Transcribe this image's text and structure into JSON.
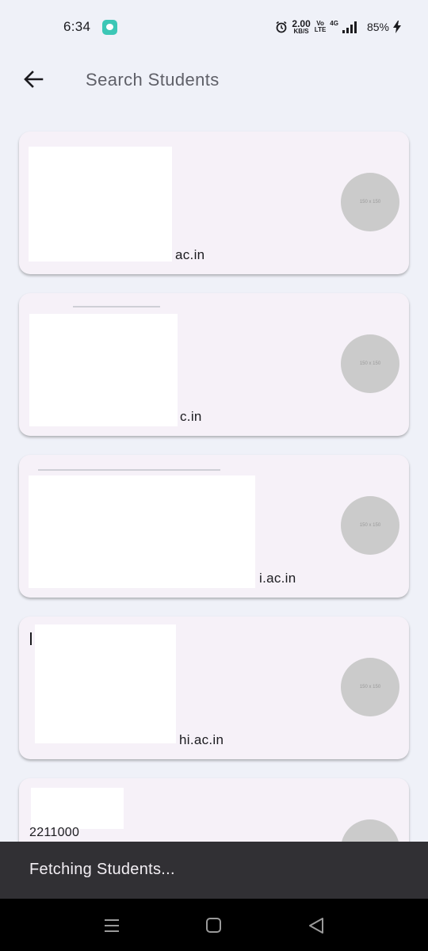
{
  "status_bar": {
    "time": "6:34",
    "net_speed_value": "2.00",
    "net_speed_unit": "KB/S",
    "volte_top": "Vo",
    "volte_bottom": "LTE",
    "network": "4G",
    "battery": "85%",
    "icons": [
      "chat-notification-icon",
      "alarm-icon",
      "signal-icon",
      "charging-bolt-icon"
    ]
  },
  "app_bar": {
    "back_icon": "arrow-left-icon",
    "search_placeholder": "Search Students"
  },
  "students": [
    {
      "email_suffix": "ac.in",
      "avatar_text": "150 x 150"
    },
    {
      "email_suffix": "c.in",
      "avatar_text": "150 x 150"
    },
    {
      "email_suffix": "i.ac.in",
      "avatar_text": "150 x 150"
    },
    {
      "email_suffix": "hi.ac.in",
      "avatar_text": "150 x 150"
    },
    {
      "partial_text": "2211000",
      "avatar_text": ""
    }
  ],
  "snackbar": {
    "message": "Fetching Students..."
  },
  "nav_bar": {
    "icons": [
      "recents-icon",
      "home-icon",
      "back-triangle-icon"
    ]
  },
  "colors": {
    "background": "#eff1f8",
    "card": "#f6f1f8",
    "avatar": "#cbcbcb",
    "snackbar": "#313034",
    "chat_icon": "#3cc7b6"
  }
}
